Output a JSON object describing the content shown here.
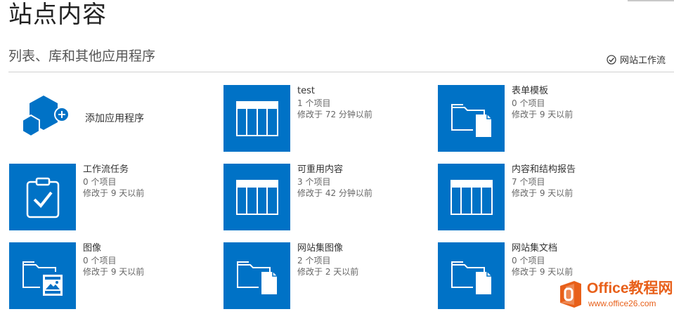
{
  "page": {
    "title": "站点内容"
  },
  "section": {
    "title": "列表、库和其他应用程序",
    "workflow_label": "网站工作流"
  },
  "add_app": {
    "label": "添加应用程序"
  },
  "tiles": [
    {
      "name": "test",
      "count": "1 个项目",
      "modified": "修改于 72 分钟以前",
      "icon": "list-icon"
    },
    {
      "name": "表单模板",
      "count": "0 个项目",
      "modified": "修改于 9 天以前",
      "icon": "document-library-icon"
    },
    {
      "name": "工作流任务",
      "count": "0 个项目",
      "modified": "修改于 9 天以前",
      "icon": "task-list-icon"
    },
    {
      "name": "可重用内容",
      "count": "3 个项目",
      "modified": "修改于 42 分钟以前",
      "icon": "list-icon"
    },
    {
      "name": "内容和结构报告",
      "count": "7 个项目",
      "modified": "修改于 9 天以前",
      "icon": "list-icon"
    },
    {
      "name": "图像",
      "count": "0 个项目",
      "modified": "修改于 9 天以前",
      "icon": "picture-library-icon"
    },
    {
      "name": "网站集图像",
      "count": "2 个项目",
      "modified": "修改于 2 天以前",
      "icon": "document-library-icon"
    },
    {
      "name": "网站集文档",
      "count": "0 个项目",
      "modified": "修改于 9 天以前",
      "icon": "document-library-icon"
    }
  ],
  "watermark": {
    "brand": "Office教程网",
    "url": "www.office26.com"
  },
  "colors": {
    "tile_blue": "#0072c6",
    "watermark_orange": "#e8601a"
  }
}
